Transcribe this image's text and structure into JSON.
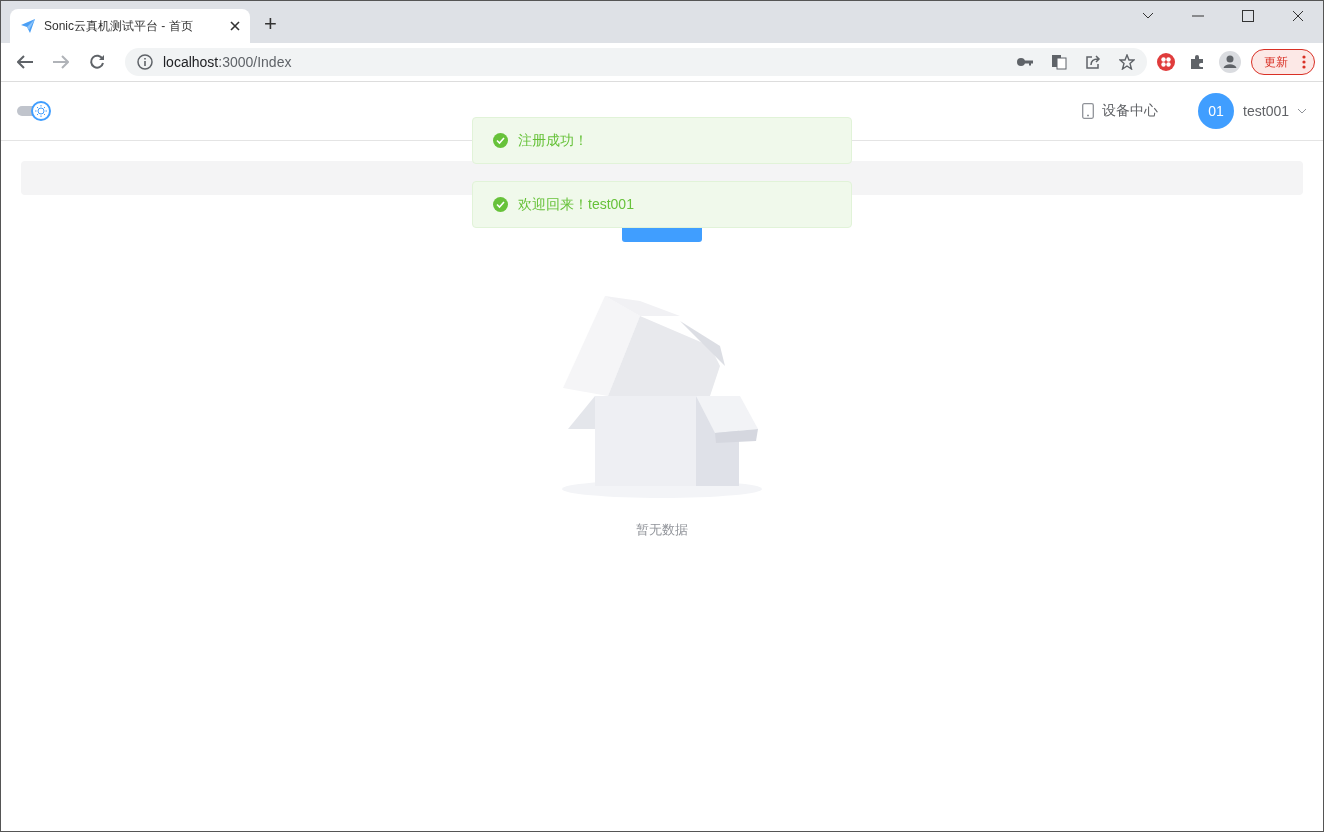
{
  "browser": {
    "tabs": [
      {
        "title": "Sonic云真机测试平台 - 首页",
        "selected": true
      }
    ],
    "new_tab": "+",
    "address": {
      "host": "localhost",
      "path": ":3000/Index"
    },
    "update_button": "更新"
  },
  "header": {
    "dark_mode": false,
    "device_center": "设备中心",
    "user": {
      "avatar": "01",
      "name": "test001"
    }
  },
  "empty": {
    "text": "暂无数据"
  },
  "messages": [
    {
      "text": "注册成功！"
    },
    {
      "text": "欢迎回来！test001"
    }
  ]
}
